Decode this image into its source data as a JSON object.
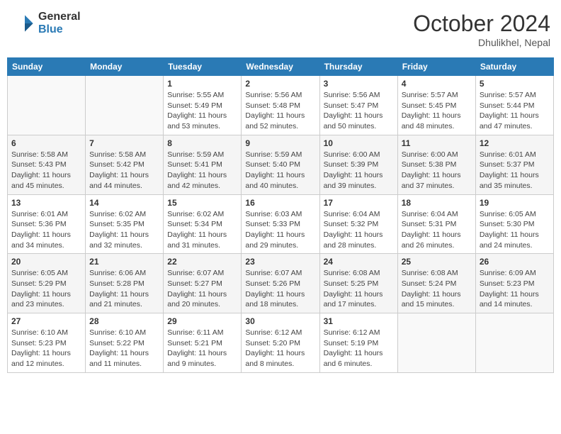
{
  "header": {
    "logo_general": "General",
    "logo_blue": "Blue",
    "month": "October 2024",
    "location": "Dhulikhel, Nepal"
  },
  "days_of_week": [
    "Sunday",
    "Monday",
    "Tuesday",
    "Wednesday",
    "Thursday",
    "Friday",
    "Saturday"
  ],
  "weeks": [
    [
      {
        "day": "",
        "sunrise": "",
        "sunset": "",
        "daylight": ""
      },
      {
        "day": "",
        "sunrise": "",
        "sunset": "",
        "daylight": ""
      },
      {
        "day": "1",
        "sunrise": "Sunrise: 5:55 AM",
        "sunset": "Sunset: 5:49 PM",
        "daylight": "Daylight: 11 hours and 53 minutes."
      },
      {
        "day": "2",
        "sunrise": "Sunrise: 5:56 AM",
        "sunset": "Sunset: 5:48 PM",
        "daylight": "Daylight: 11 hours and 52 minutes."
      },
      {
        "day": "3",
        "sunrise": "Sunrise: 5:56 AM",
        "sunset": "Sunset: 5:47 PM",
        "daylight": "Daylight: 11 hours and 50 minutes."
      },
      {
        "day": "4",
        "sunrise": "Sunrise: 5:57 AM",
        "sunset": "Sunset: 5:45 PM",
        "daylight": "Daylight: 11 hours and 48 minutes."
      },
      {
        "day": "5",
        "sunrise": "Sunrise: 5:57 AM",
        "sunset": "Sunset: 5:44 PM",
        "daylight": "Daylight: 11 hours and 47 minutes."
      }
    ],
    [
      {
        "day": "6",
        "sunrise": "Sunrise: 5:58 AM",
        "sunset": "Sunset: 5:43 PM",
        "daylight": "Daylight: 11 hours and 45 minutes."
      },
      {
        "day": "7",
        "sunrise": "Sunrise: 5:58 AM",
        "sunset": "Sunset: 5:42 PM",
        "daylight": "Daylight: 11 hours and 44 minutes."
      },
      {
        "day": "8",
        "sunrise": "Sunrise: 5:59 AM",
        "sunset": "Sunset: 5:41 PM",
        "daylight": "Daylight: 11 hours and 42 minutes."
      },
      {
        "day": "9",
        "sunrise": "Sunrise: 5:59 AM",
        "sunset": "Sunset: 5:40 PM",
        "daylight": "Daylight: 11 hours and 40 minutes."
      },
      {
        "day": "10",
        "sunrise": "Sunrise: 6:00 AM",
        "sunset": "Sunset: 5:39 PM",
        "daylight": "Daylight: 11 hours and 39 minutes."
      },
      {
        "day": "11",
        "sunrise": "Sunrise: 6:00 AM",
        "sunset": "Sunset: 5:38 PM",
        "daylight": "Daylight: 11 hours and 37 minutes."
      },
      {
        "day": "12",
        "sunrise": "Sunrise: 6:01 AM",
        "sunset": "Sunset: 5:37 PM",
        "daylight": "Daylight: 11 hours and 35 minutes."
      }
    ],
    [
      {
        "day": "13",
        "sunrise": "Sunrise: 6:01 AM",
        "sunset": "Sunset: 5:36 PM",
        "daylight": "Daylight: 11 hours and 34 minutes."
      },
      {
        "day": "14",
        "sunrise": "Sunrise: 6:02 AM",
        "sunset": "Sunset: 5:35 PM",
        "daylight": "Daylight: 11 hours and 32 minutes."
      },
      {
        "day": "15",
        "sunrise": "Sunrise: 6:02 AM",
        "sunset": "Sunset: 5:34 PM",
        "daylight": "Daylight: 11 hours and 31 minutes."
      },
      {
        "day": "16",
        "sunrise": "Sunrise: 6:03 AM",
        "sunset": "Sunset: 5:33 PM",
        "daylight": "Daylight: 11 hours and 29 minutes."
      },
      {
        "day": "17",
        "sunrise": "Sunrise: 6:04 AM",
        "sunset": "Sunset: 5:32 PM",
        "daylight": "Daylight: 11 hours and 28 minutes."
      },
      {
        "day": "18",
        "sunrise": "Sunrise: 6:04 AM",
        "sunset": "Sunset: 5:31 PM",
        "daylight": "Daylight: 11 hours and 26 minutes."
      },
      {
        "day": "19",
        "sunrise": "Sunrise: 6:05 AM",
        "sunset": "Sunset: 5:30 PM",
        "daylight": "Daylight: 11 hours and 24 minutes."
      }
    ],
    [
      {
        "day": "20",
        "sunrise": "Sunrise: 6:05 AM",
        "sunset": "Sunset: 5:29 PM",
        "daylight": "Daylight: 11 hours and 23 minutes."
      },
      {
        "day": "21",
        "sunrise": "Sunrise: 6:06 AM",
        "sunset": "Sunset: 5:28 PM",
        "daylight": "Daylight: 11 hours and 21 minutes."
      },
      {
        "day": "22",
        "sunrise": "Sunrise: 6:07 AM",
        "sunset": "Sunset: 5:27 PM",
        "daylight": "Daylight: 11 hours and 20 minutes."
      },
      {
        "day": "23",
        "sunrise": "Sunrise: 6:07 AM",
        "sunset": "Sunset: 5:26 PM",
        "daylight": "Daylight: 11 hours and 18 minutes."
      },
      {
        "day": "24",
        "sunrise": "Sunrise: 6:08 AM",
        "sunset": "Sunset: 5:25 PM",
        "daylight": "Daylight: 11 hours and 17 minutes."
      },
      {
        "day": "25",
        "sunrise": "Sunrise: 6:08 AM",
        "sunset": "Sunset: 5:24 PM",
        "daylight": "Daylight: 11 hours and 15 minutes."
      },
      {
        "day": "26",
        "sunrise": "Sunrise: 6:09 AM",
        "sunset": "Sunset: 5:23 PM",
        "daylight": "Daylight: 11 hours and 14 minutes."
      }
    ],
    [
      {
        "day": "27",
        "sunrise": "Sunrise: 6:10 AM",
        "sunset": "Sunset: 5:23 PM",
        "daylight": "Daylight: 11 hours and 12 minutes."
      },
      {
        "day": "28",
        "sunrise": "Sunrise: 6:10 AM",
        "sunset": "Sunset: 5:22 PM",
        "daylight": "Daylight: 11 hours and 11 minutes."
      },
      {
        "day": "29",
        "sunrise": "Sunrise: 6:11 AM",
        "sunset": "Sunset: 5:21 PM",
        "daylight": "Daylight: 11 hours and 9 minutes."
      },
      {
        "day": "30",
        "sunrise": "Sunrise: 6:12 AM",
        "sunset": "Sunset: 5:20 PM",
        "daylight": "Daylight: 11 hours and 8 minutes."
      },
      {
        "day": "31",
        "sunrise": "Sunrise: 6:12 AM",
        "sunset": "Sunset: 5:19 PM",
        "daylight": "Daylight: 11 hours and 6 minutes."
      },
      {
        "day": "",
        "sunrise": "",
        "sunset": "",
        "daylight": ""
      },
      {
        "day": "",
        "sunrise": "",
        "sunset": "",
        "daylight": ""
      }
    ]
  ]
}
